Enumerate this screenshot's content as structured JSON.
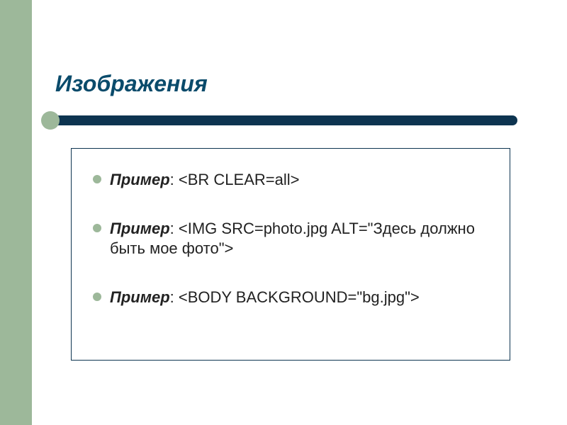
{
  "title": "Изображения",
  "items": [
    {
      "label": "Пример",
      "text": ": <BR CLEAR=all>"
    },
    {
      "label": "Пример",
      "text": ": <IMG SRC=photo.jpg ALT=\"Здесь должно быть мое фото\">"
    },
    {
      "label": "Пример",
      "text": ": <BODY BACKGROUND=\"bg.jpg\">"
    }
  ]
}
